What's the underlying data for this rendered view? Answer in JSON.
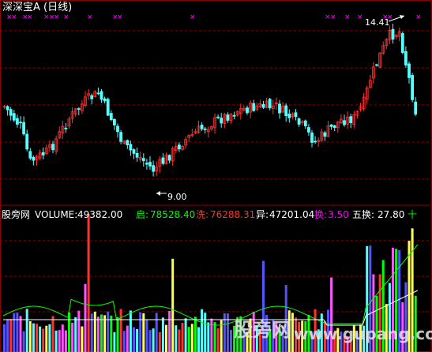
{
  "window_title": "深深宝A (日线)",
  "price_panel": {
    "high_label": "14.41",
    "low_label": "9.00"
  },
  "indicator_panel": {
    "name": "股旁网",
    "volume_label": "VOLUME:",
    "volume_value": "49382.00",
    "fields": [
      {
        "label": "启:",
        "value": "78528.40",
        "color": "#00ff00"
      },
      {
        "label": "洗:",
        "value": "76288.31",
        "color": "#ff3333"
      },
      {
        "label": "异:",
        "value": "47201.04",
        "color": "#ffffff"
      },
      {
        "label": "换:",
        "value": "3.50",
        "color": "#ff00ff"
      },
      {
        "label": "五换:",
        "value": "27.80",
        "color": "#ffffff"
      },
      {
        "label": "十",
        "value": "",
        "color": "#00ff00"
      }
    ]
  },
  "watermark": {
    "brand": "股旁网",
    "url": "www.gupang.com"
  },
  "colors": {
    "up": "#ff3232",
    "down": "#54ffff",
    "grid": "#8b0000",
    "volume_yellow": "#ffff54",
    "volume_magenta": "#ff54ff",
    "volume_blue": "#5454ff",
    "ma_green": "#00ff00",
    "ma_white": "#ffffff",
    "marker": "#ff00ff"
  }
}
